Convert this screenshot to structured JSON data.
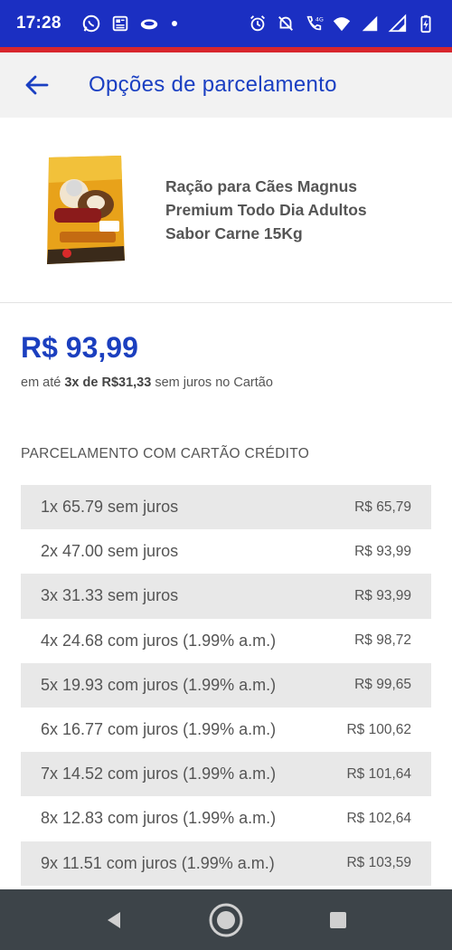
{
  "status_bar": {
    "time": "17:28",
    "network": "4G",
    "colors": {
      "background": "#1b2fc2",
      "accent_line": "#d8262d"
    }
  },
  "header": {
    "title": "Opções de parcelamento",
    "back_icon": "arrow-left-icon"
  },
  "product": {
    "name": "Ração para Cães Magnus Premium Todo Dia Adultos Sabor Carne 15Kg",
    "image_icon": "product-bag-image"
  },
  "pricing": {
    "price": "R$ 93,99",
    "installment_prefix": "em até ",
    "installment_highlight": "3x de R$31,33",
    "installment_suffix": " sem juros no Cartão"
  },
  "credit_section": {
    "title": "PARCELAMENTO COM CARTÃO CRÉDITO",
    "plans": [
      {
        "label": "1x 65.79 sem juros",
        "total": "R$ 65,79"
      },
      {
        "label": "2x 47.00 sem juros",
        "total": "R$ 93,99"
      },
      {
        "label": "3x 31.33 sem juros",
        "total": "R$ 93,99"
      },
      {
        "label": "4x 24.68 com juros (1.99% a.m.)",
        "total": "R$ 98,72"
      },
      {
        "label": "5x 19.93 com juros (1.99% a.m.)",
        "total": "R$ 99,65"
      },
      {
        "label": "6x 16.77 com juros (1.99% a.m.)",
        "total": "R$ 100,62"
      },
      {
        "label": "7x 14.52 com juros (1.99% a.m.)",
        "total": "R$ 101,64"
      },
      {
        "label": "8x 12.83 com juros (1.99% a.m.)",
        "total": "R$ 102,64"
      },
      {
        "label": "9x 11.51 com juros (1.99% a.m.)",
        "total": "R$ 103,59"
      }
    ]
  },
  "nav_bar": {
    "buttons": [
      "back-triangle-icon",
      "home-circle-icon",
      "recents-square-icon"
    ]
  }
}
